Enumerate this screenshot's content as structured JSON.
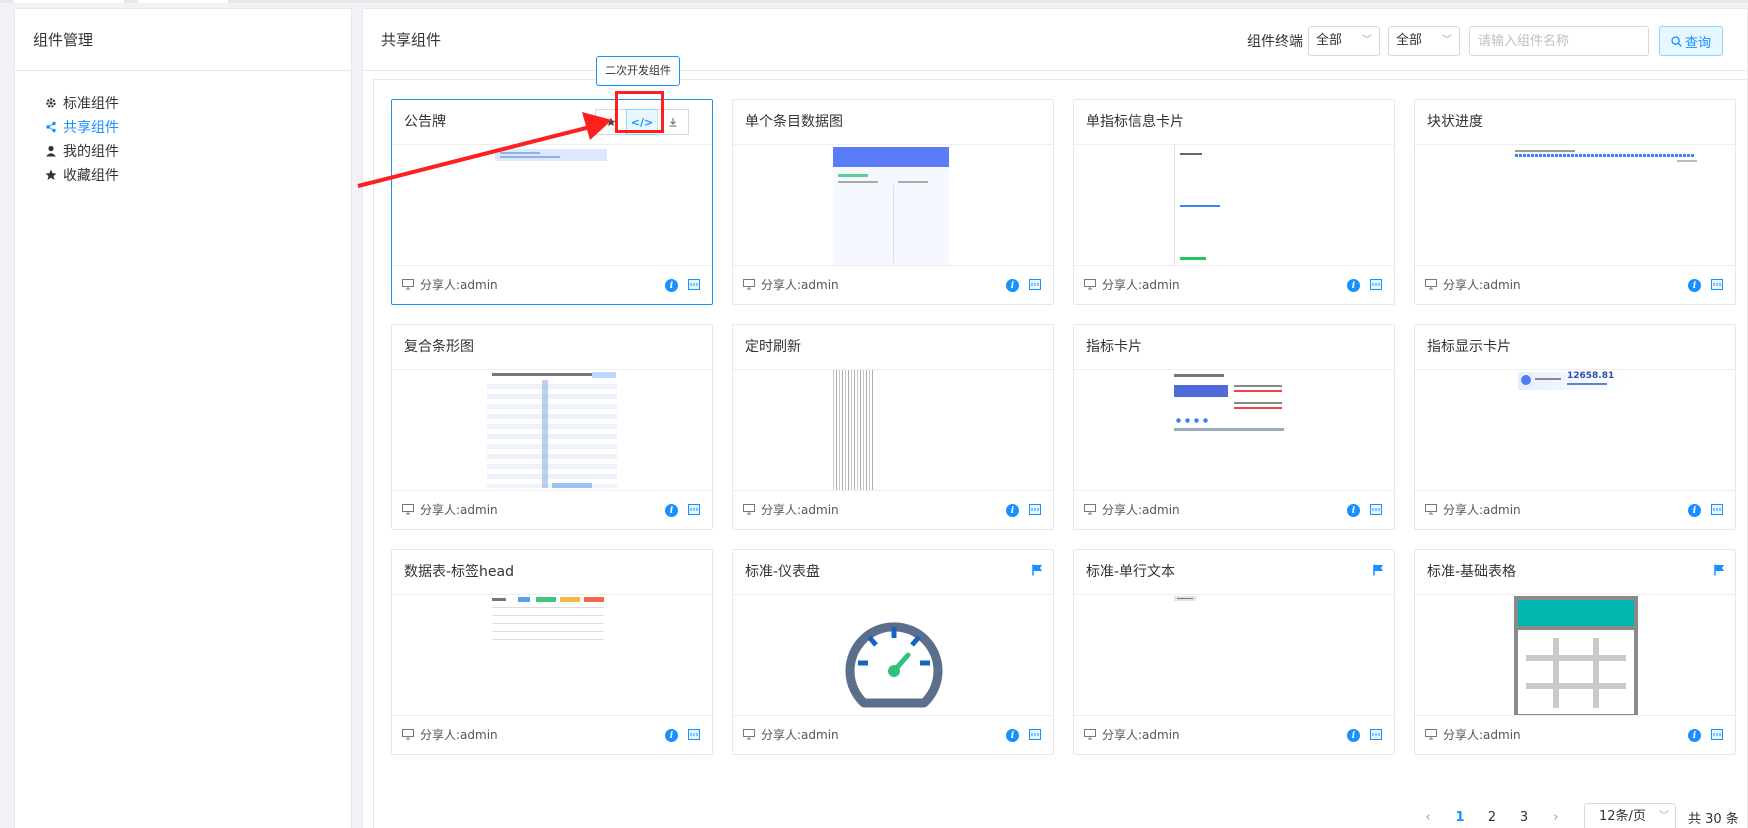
{
  "sidebar": {
    "title": "组件管理",
    "items": [
      {
        "label": "标准组件",
        "icon": "gear-icon"
      },
      {
        "label": "共享组件",
        "icon": "share-icon",
        "active": true
      },
      {
        "label": "我的组件",
        "icon": "user-icon"
      },
      {
        "label": "收藏组件",
        "icon": "star-icon"
      }
    ]
  },
  "header": {
    "title": "共享组件",
    "filter_label": "组件终端",
    "select1": "全部",
    "select2": "全部",
    "search_placeholder": "请输入组件名称",
    "query_label": "查询"
  },
  "tooltip": "二次开发组件",
  "cards": [
    {
      "title": "公告牌",
      "sharer": "分享人:admin",
      "selected": true,
      "actions": [
        "star",
        "code",
        "download"
      ]
    },
    {
      "title": "单个条目数据图",
      "sharer": "分享人:admin"
    },
    {
      "title": "单指标信息卡片",
      "sharer": "分享人:admin"
    },
    {
      "title": "块状进度",
      "sharer": "分享人:admin"
    },
    {
      "title": "复合条形图",
      "sharer": "分享人:admin"
    },
    {
      "title": "定时刷新",
      "sharer": "分享人:admin"
    },
    {
      "title": "指标卡片",
      "sharer": "分享人:admin"
    },
    {
      "title": "指标显示卡片",
      "sharer": "分享人:admin"
    },
    {
      "title": "数据表-标签head",
      "sharer": "分享人:admin"
    },
    {
      "title": "标准-仪表盘",
      "sharer": "分享人:admin",
      "flag": true
    },
    {
      "title": "标准-单行文本",
      "sharer": "分享人:admin",
      "flag": true
    },
    {
      "title": "标准-基础表格",
      "sharer": "分享人:admin",
      "flag": true
    }
  ],
  "preview_texts": {
    "indicator_display_value": "12658.81"
  },
  "pagination": {
    "pages": [
      "1",
      "2",
      "3"
    ],
    "current": "1",
    "page_size": "12条/页",
    "total": "共 30 条"
  },
  "colors": {
    "accent": "#1890ff",
    "annotation_red": "#ff1f1f",
    "gauge_blue": "#1565c0",
    "gauge_green": "#2ec27e",
    "table_teal": "#00b8b0"
  }
}
